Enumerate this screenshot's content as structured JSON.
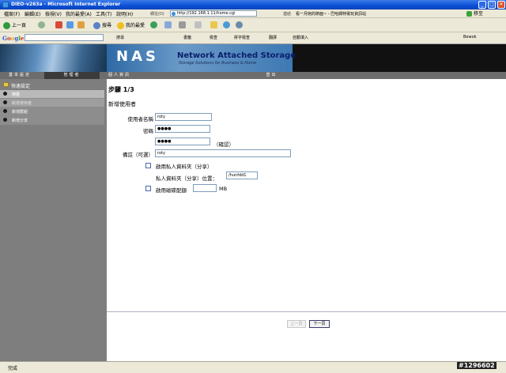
{
  "window": {
    "title": "DIEO-v263a - Microsoft Internet Explorer",
    "min": "_",
    "max": "□",
    "close": "✕"
  },
  "menu": {
    "items": [
      "檔案(F)",
      "編輯(E)",
      "檢視(V)",
      "我的最愛(A)",
      "工具(T)",
      "說明(H)"
    ],
    "address_label": "網址(D)",
    "address": "http://192.168.1.11/home.cgi",
    "links_label": "連結",
    "links_text": "看一月她的節面~ - 巴哈姆特電玩資訊站",
    "go": "移至"
  },
  "toolbar": {
    "back": "上一頁",
    "search": "搜尋",
    "favorites": "我的最愛"
  },
  "google": {
    "logo": "Google",
    "search_btn": "搜尋",
    "bookmarks": "書籤",
    "check": "檢查",
    "spell": "拼字檢查",
    "translate": "翻譯",
    "autofill": "自動填入",
    "user": "Bewok"
  },
  "banner": {
    "logo": "NAS",
    "title": "Network Attached Storage",
    "subtitle": "Storage Solutions for Business & Home"
  },
  "nav": {
    "tabs": [
      "基本設定",
      "管理者",
      "個人資訊",
      "登出"
    ]
  },
  "sidebar": {
    "header": "快速設定",
    "items": [
      "精靈",
      "新增使用者",
      "新增群組",
      "新增分享"
    ]
  },
  "form": {
    "step": "步驟 1/3",
    "section": "新增使用者",
    "username_label": "使用者名稱",
    "username_value": "roty",
    "password_label": "密碼",
    "password_value": "●●●●",
    "confirm_value": "●●●●",
    "confirm_label": "（確認）",
    "comment_label": "備註（可選）",
    "comment_value": "roty",
    "private_share_label": "啟用私人資料夾（分享）",
    "private_share_path_label": "私人資料夾（分享）位置：",
    "private_share_path_value": "/hunfdd1",
    "quota_label": "啟用磁碟配額",
    "quota_unit": "MB",
    "quota_value": ""
  },
  "buttons": {
    "prev": "上一頁",
    "next": "下一頁"
  },
  "status": {
    "text": "完成",
    "watermark": "#1296602"
  }
}
